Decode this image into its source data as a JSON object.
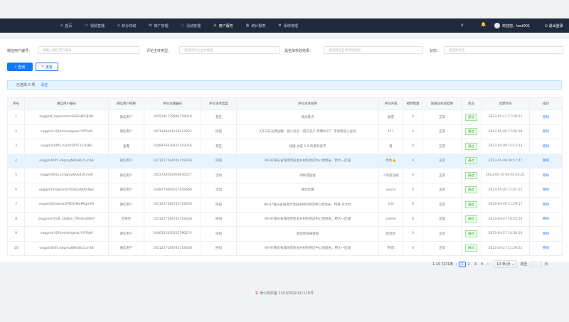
{
  "nav": [
    {
      "icon": "⌂",
      "label": "首页"
    },
    {
      "icon": "▭",
      "label": "视频直播"
    },
    {
      "icon": "⌂",
      "label": "积分商城"
    },
    {
      "icon": "⚙",
      "label": "推广管理"
    },
    {
      "icon": "♨",
      "label": "活动管理"
    },
    {
      "icon": "♙",
      "label": "用户服务"
    },
    {
      "icon": "▥",
      "label": "统计报表"
    },
    {
      "icon": "⚙",
      "label": "系统管理"
    }
  ],
  "header": {
    "search_icon": "⌕",
    "bell_icon": "🔔",
    "welcome": "欢迎您，test001",
    "logout": "退出登录",
    "logout_icon": "⏻"
  },
  "filters": {
    "user_no_label": "微信用户编号：",
    "user_no_placeholder": "请输入微信用户编号",
    "subject_label": "评论主体类型：",
    "subject_placeholder": "请选择评论主体类型",
    "audit_label": "黑名单校验结果：",
    "audit_placeholder": "请选择黑名单校验结果",
    "status_label": "状态：",
    "status_placeholder": "请选择状态"
  },
  "buttons": {
    "search": "查询",
    "reset": "重置",
    "search_icon": "⌕",
    "reset_icon": "↻"
  },
  "selection": {
    "text": "已选择 0 项",
    "clear": "清空"
  },
  "table": {
    "headers": [
      "序号",
      "微信用户编号",
      "微信用户昵称",
      "评论主题编号",
      "评论主体类型",
      "评论主体名称",
      "评论内容",
      "被赞数量",
      "屏蔽词校验结果",
      "状态",
      "创建时间",
      "操作"
    ],
    "rows": [
      [
        "1",
        "oeggm4_hqwmrotrhGKi6eN03Jt4k",
        "微信用户",
        "1655581779996758010",
        "景区",
        "测试景点",
        "秘密",
        "0",
        "正常",
        "通过",
        "2023-05-11 17:20:51",
        "移除"
      ],
      [
        "2",
        "oeggm4-QRhmhmfgwokrYYfSoM",
        "微信用户",
        "1651184441158113022",
        "民宿",
        "3万日东东费运路：城入北七（成欠农户 所明水工厂 华地物流入主处",
        "111",
        "0",
        "正常",
        "通过",
        "2023-05-05 17:56:18",
        "移除"
      ],
      [
        "3",
        "oeggm40Rfu-bizUK2K5F1x3U8U",
        "张鑫",
        "1648978436421142016",
        "景区",
        "经理 太安 1.0 的景有诗学",
        "看",
        "0",
        "正常",
        "通过",
        "2023-05-09 15:12:33",
        "移除"
      ],
      [
        "4",
        "oeggm40ift.vdlgmqNKfo8UcLmA8",
        "微信用户",
        "1651257184744718338",
        "民宿",
        "96-97黄东省城地市民会乡村的青店中心地场米，特大一区域",
        "优秀👍",
        "0",
        "正常",
        "通过",
        "2023-05-08 00:57:47",
        "移除"
      ],
      [
        "5",
        "oeggm40iLLvd4gmpNUb4ULmA8",
        "微信用户",
        "1653748582906630327",
        "活动",
        "中秋游园会",
        "⚠内容违规",
        "0",
        "正常",
        "通过",
        "2023-05-10 00:03:22:21",
        "移除"
      ],
      [
        "6",
        "oeggm4-hqwmrotrhGKjEsN0D3fpk",
        "微信用户",
        "1648776692017456666",
        "活动",
        "律动比赛",
        "wocel",
        "0",
        "正常",
        "通过",
        "2023-05-05 11:01:52",
        "移除"
      ],
      [
        "7",
        "oeggm4JGsbmd2fHKQHKo9KqmA4",
        "微信用户",
        "1651237184744718330",
        "民宿",
        "96-97进东省城会市场县多村的青店中心地场米，特基 东大村",
        "233",
        "0",
        "正常",
        "通过",
        "2023-04-29 11:29:17",
        "移除"
      ],
      [
        "8",
        "oeggm4cYluR_CE8Qe_Tf6HsGQENY",
        "宏先生",
        "1651257184744718338",
        "民宿",
        "96-97黄东省城地市民会乡村的青店中心地场米，特大一区域",
        "tellme",
        "0",
        "正常",
        "通过",
        "2023-04-27 16:25:16",
        "移除"
      ],
      [
        "9",
        "oeggm4-QRhmhmfgwokrYYfSoM",
        "微信用户",
        "1640323450525790274",
        "民宿",
        "测试你就来就呢",
        "娃娃娃",
        "0",
        "正常",
        "通过",
        "2023-04-27 14:30:10",
        "移除"
      ],
      [
        "10",
        "oeggm40ift.vdlgmqNKfo8UcLmA8",
        "微信用户",
        "1651257184744718338",
        "民宿",
        "96-97黄东省城地市民会乡村的青店中心地场米，特大一区域",
        "不错!",
        "0",
        "正常",
        "通过",
        "2023-04-27 11:29:25",
        "移除"
      ]
    ]
  },
  "pagination": {
    "summary": "1-10 共31条",
    "prev": "‹",
    "pages": [
      "1",
      "2",
      "3",
      "4"
    ],
    "next": "›",
    "size": "10 条/页 ⌄",
    "goto": "跳至",
    "page_unit": "页"
  },
  "footer": {
    "text": "津公网安备 12010502001118号",
    "icon": "⛨"
  },
  "colors": {
    "primary": "#1677ff",
    "topbar": "#1f2a3c",
    "status_green": "#3aa23a"
  }
}
